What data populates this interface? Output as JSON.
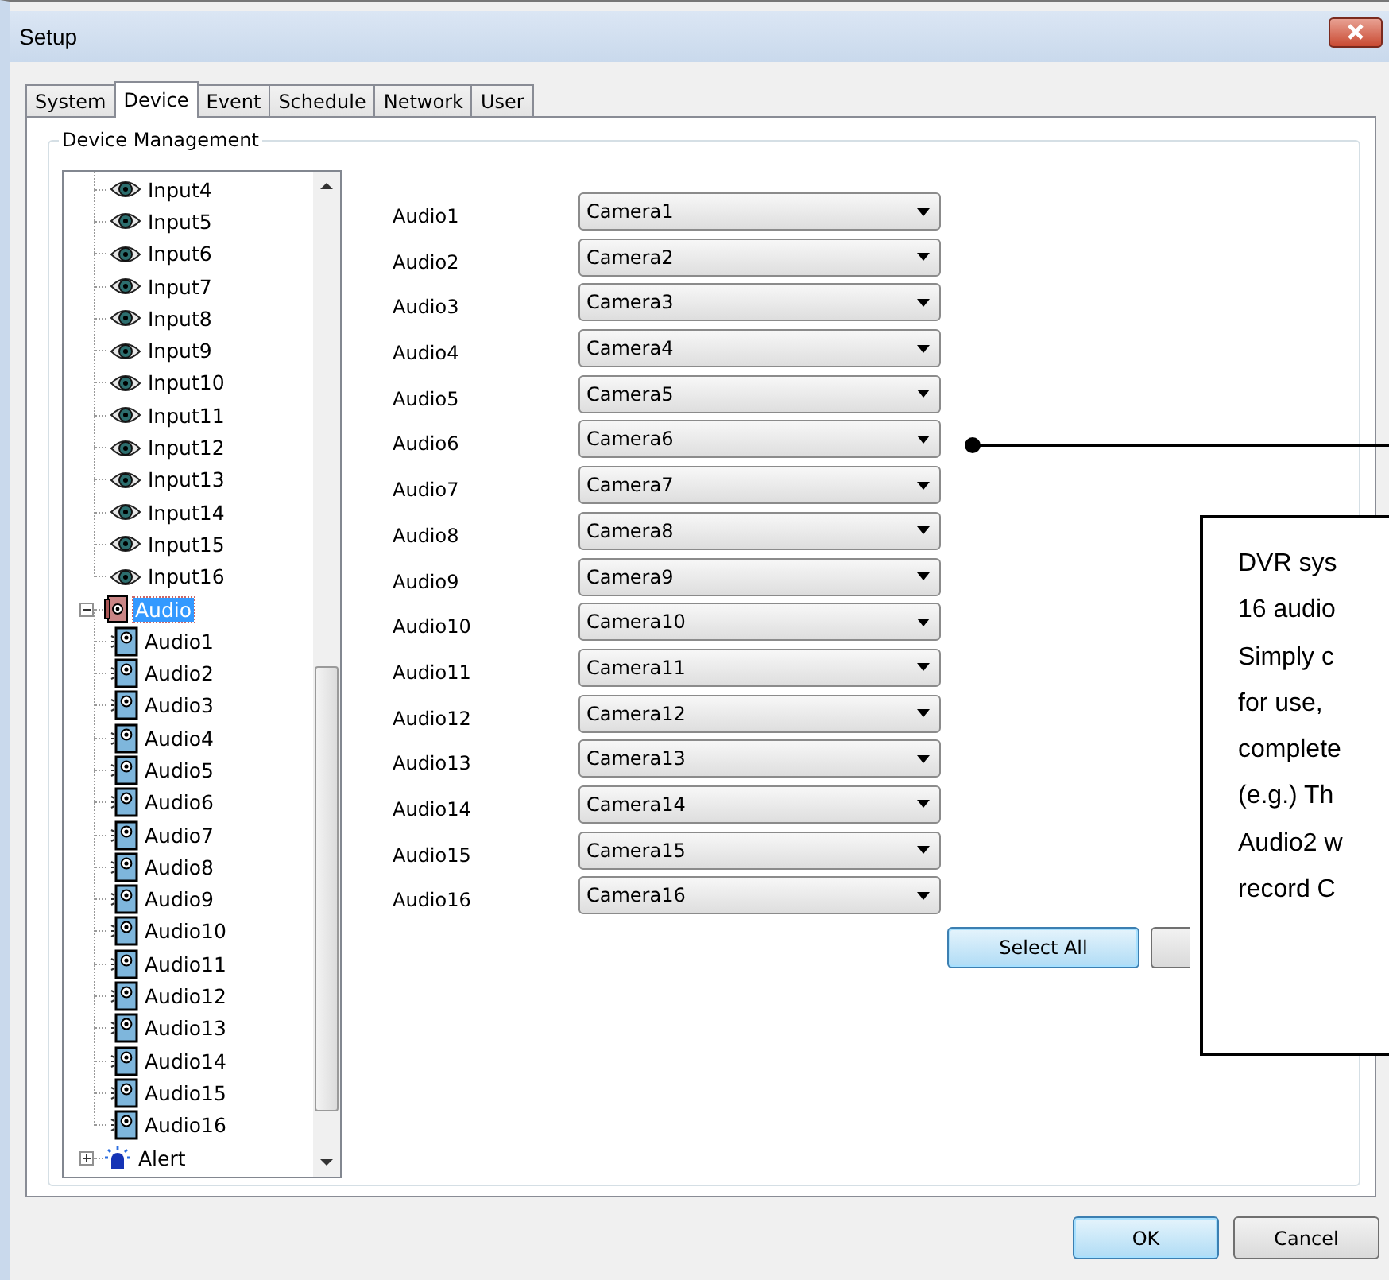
{
  "window": {
    "title": "Setup"
  },
  "tabs": [
    {
      "label": "System",
      "selected": false
    },
    {
      "label": "Device",
      "selected": true
    },
    {
      "label": "Event",
      "selected": false
    },
    {
      "label": "Schedule",
      "selected": false
    },
    {
      "label": "Network",
      "selected": false
    },
    {
      "label": "User",
      "selected": false
    }
  ],
  "group": {
    "title": "Device Management"
  },
  "tree": {
    "items": [
      {
        "children": [
          {
            "label": "Input4",
            "kind": "input"
          },
          {
            "label": "Input5",
            "kind": "input"
          },
          {
            "label": "Input6",
            "kind": "input"
          },
          {
            "label": "Input7",
            "kind": "input"
          },
          {
            "label": "Input8",
            "kind": "input"
          },
          {
            "label": "Input9",
            "kind": "input"
          },
          {
            "label": "Input10",
            "kind": "input"
          },
          {
            "label": "Input11",
            "kind": "input"
          },
          {
            "label": "Input12",
            "kind": "input"
          },
          {
            "label": "Input13",
            "kind": "input"
          },
          {
            "label": "Input14",
            "kind": "input"
          },
          {
            "label": "Input15",
            "kind": "input"
          },
          {
            "label": "Input16",
            "kind": "input"
          }
        ]
      },
      {
        "label": "Audio",
        "kind": "audio-group",
        "selected": true,
        "expanded": true,
        "children": [
          {
            "label": "Audio1",
            "kind": "audio"
          },
          {
            "label": "Audio2",
            "kind": "audio"
          },
          {
            "label": "Audio3",
            "kind": "audio"
          },
          {
            "label": "Audio4",
            "kind": "audio"
          },
          {
            "label": "Audio5",
            "kind": "audio"
          },
          {
            "label": "Audio6",
            "kind": "audio"
          },
          {
            "label": "Audio7",
            "kind": "audio"
          },
          {
            "label": "Audio8",
            "kind": "audio"
          },
          {
            "label": "Audio9",
            "kind": "audio"
          },
          {
            "label": "Audio10",
            "kind": "audio"
          },
          {
            "label": "Audio11",
            "kind": "audio"
          },
          {
            "label": "Audio12",
            "kind": "audio"
          },
          {
            "label": "Audio13",
            "kind": "audio"
          },
          {
            "label": "Audio14",
            "kind": "audio"
          },
          {
            "label": "Audio15",
            "kind": "audio"
          },
          {
            "label": "Audio16",
            "kind": "audio"
          }
        ]
      },
      {
        "label": "Alert",
        "kind": "alert",
        "selected": false,
        "expanded": false
      }
    ]
  },
  "mappings": [
    {
      "label": "Audio1",
      "value": "Camera1"
    },
    {
      "label": "Audio2",
      "value": "Camera2"
    },
    {
      "label": "Audio3",
      "value": "Camera3"
    },
    {
      "label": "Audio4",
      "value": "Camera4"
    },
    {
      "label": "Audio5",
      "value": "Camera5"
    },
    {
      "label": "Audio6",
      "value": "Camera6"
    },
    {
      "label": "Audio7",
      "value": "Camera7"
    },
    {
      "label": "Audio8",
      "value": "Camera8"
    },
    {
      "label": "Audio9",
      "value": "Camera9"
    },
    {
      "label": "Audio10",
      "value": "Camera10"
    },
    {
      "label": "Audio11",
      "value": "Camera11"
    },
    {
      "label": "Audio12",
      "value": "Camera12"
    },
    {
      "label": "Audio13",
      "value": "Camera13"
    },
    {
      "label": "Audio14",
      "value": "Camera14"
    },
    {
      "label": "Audio15",
      "value": "Camera15"
    },
    {
      "label": "Audio16",
      "value": "Camera16"
    }
  ],
  "select_all": {
    "label": "Select All"
  },
  "callout": {
    "lines": [
      "DVR sys",
      "16 audio",
      "Simply c",
      "for use,",
      "complete",
      "(e.g.) Th",
      "Audio2 w",
      "record C"
    ]
  },
  "footer_buttons": [
    {
      "label": "OK",
      "default": true
    },
    {
      "label": "Cancel",
      "default": false
    }
  ]
}
